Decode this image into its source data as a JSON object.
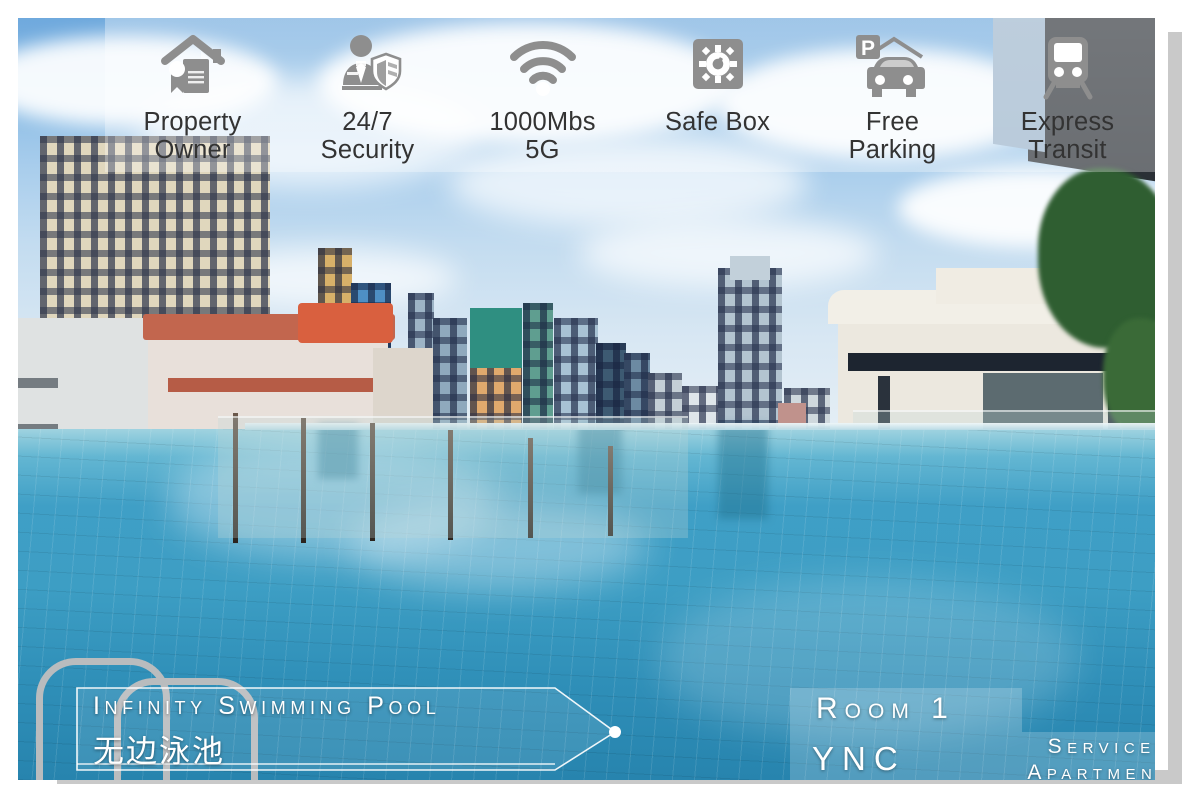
{
  "features": [
    {
      "icon": "property-owner-icon",
      "label": "Property\nOwner"
    },
    {
      "icon": "security-guard-shield-icon",
      "label": "24/7\nSecurity"
    },
    {
      "icon": "wifi-icon",
      "label": "1000Mbs\n5G"
    },
    {
      "icon": "safe-box-icon",
      "label": "Safe Box"
    },
    {
      "icon": "parking-car-icon",
      "label": "Free\nParking"
    },
    {
      "icon": "train-icon",
      "label": "Express\nTransit"
    }
  ],
  "caption": {
    "english": "Infinity Swimming Pool",
    "chinese": "无边泳池"
  },
  "branding": {
    "room": "Room 1",
    "company": "YNC",
    "type_line1": "Serviced",
    "type_line2": "Apartment"
  },
  "colors": {
    "icon_gray": "#8e8e8e",
    "text_dark": "#333333",
    "overlay_white": "#ffffff",
    "frame_gray": "#c9c9c9",
    "pool_blue": "#3d9ec4",
    "sky_blue": "#85b9e4"
  }
}
